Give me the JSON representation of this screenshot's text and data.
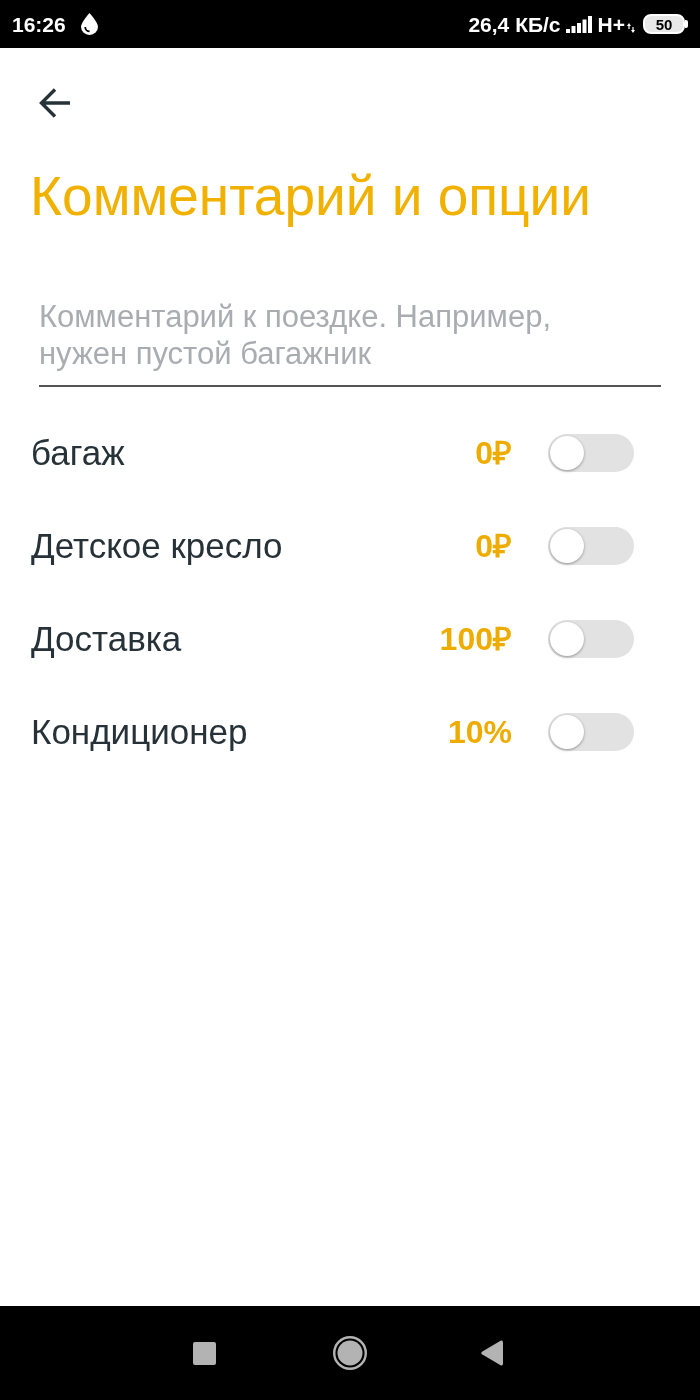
{
  "status_bar": {
    "time": "16:26",
    "network_speed": "26,4 КБ/с",
    "network_type": "H+",
    "battery": "50"
  },
  "header": {
    "title": "Комментарий и опции"
  },
  "comment_field": {
    "placeholder": "Комментарий к поездке. Например, нужен пустой багажник"
  },
  "options": [
    {
      "label": "багаж",
      "price": "0₽",
      "on": false
    },
    {
      "label": "Детское кресло",
      "price": "0₽",
      "on": false
    },
    {
      "label": "Доставка",
      "price": "100₽",
      "on": false
    },
    {
      "label": "Кондиционер",
      "price": "10%",
      "on": false
    }
  ]
}
